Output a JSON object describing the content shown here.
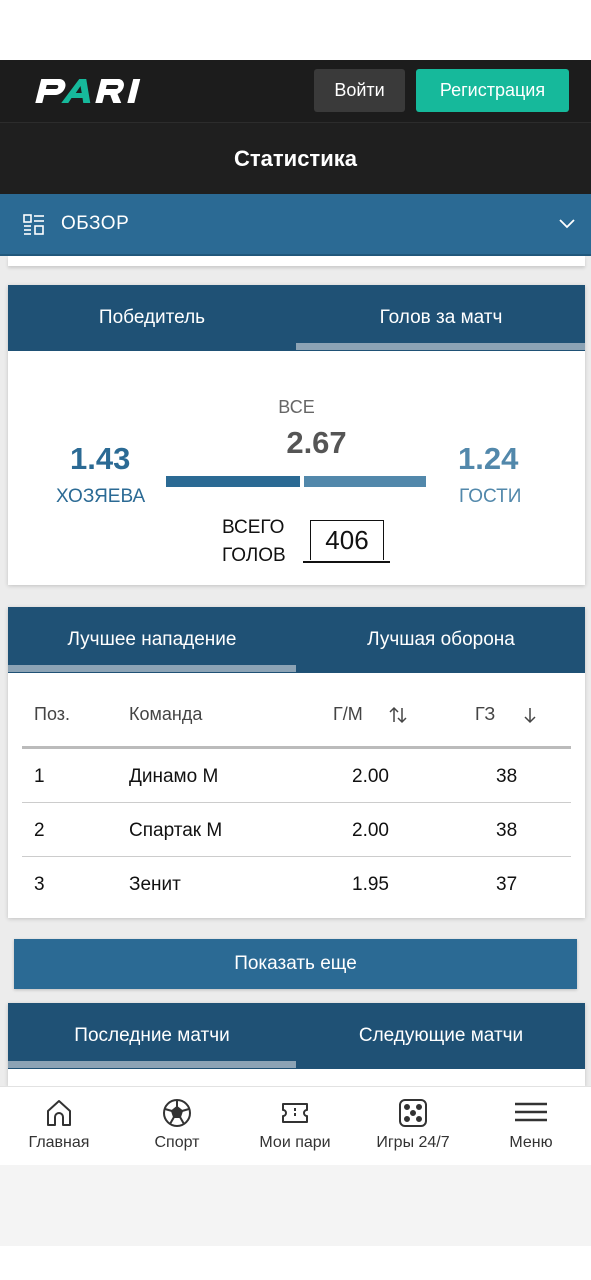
{
  "header": {
    "logo_text": "PARI",
    "login_label": "Войти",
    "register_label": "Регистрация",
    "register_color": "#16b99b"
  },
  "page_title": "Статистика",
  "overview": {
    "label": "ОБЗОР",
    "icon": "grid-list-icon",
    "chevron": "chevron-down-icon"
  },
  "goals_card": {
    "tabs": [
      "Победитель",
      "Голов за матч"
    ],
    "active_tab": "Голов за матч",
    "all_label": "ВСЕ",
    "all_value": "2.67",
    "home_value": "1.43",
    "home_label": "ХОЗЯЕВА",
    "away_value": "1.24",
    "away_label": "ГОСТИ",
    "total_label": "ВСЕГО ГОЛОВ",
    "total_value": "406",
    "home_color": "#2b6a94",
    "away_color": "#5288ab"
  },
  "best_card": {
    "tabs": [
      "Лучшее нападение",
      "Лучшая оборона"
    ],
    "active_tab": "Лучшее нападение",
    "columns": [
      "Поз.",
      "Команда",
      "Г/М",
      "ГЗ"
    ],
    "rows": [
      {
        "pos": "1",
        "team": "Динамо М",
        "gm": "2.00",
        "gz": "38"
      },
      {
        "pos": "2",
        "team": "Спартак М",
        "gm": "2.00",
        "gz": "38"
      },
      {
        "pos": "3",
        "team": "Зенит",
        "gm": "1.95",
        "gz": "37"
      }
    ]
  },
  "show_more_label": "Показать еще",
  "matches_card": {
    "tabs": [
      "Последние матчи",
      "Следующие матчи"
    ],
    "active_tab": "Последние матчи"
  },
  "bottom_nav": [
    {
      "label": "Главная",
      "icon": "home-icon"
    },
    {
      "label": "Спорт",
      "icon": "soccer-ball-icon"
    },
    {
      "label": "Мои пари",
      "icon": "ticket-icon"
    },
    {
      "label": "Игры 24/7",
      "icon": "dice-icon"
    },
    {
      "label": "Меню",
      "icon": "hamburger-menu-icon"
    }
  ]
}
